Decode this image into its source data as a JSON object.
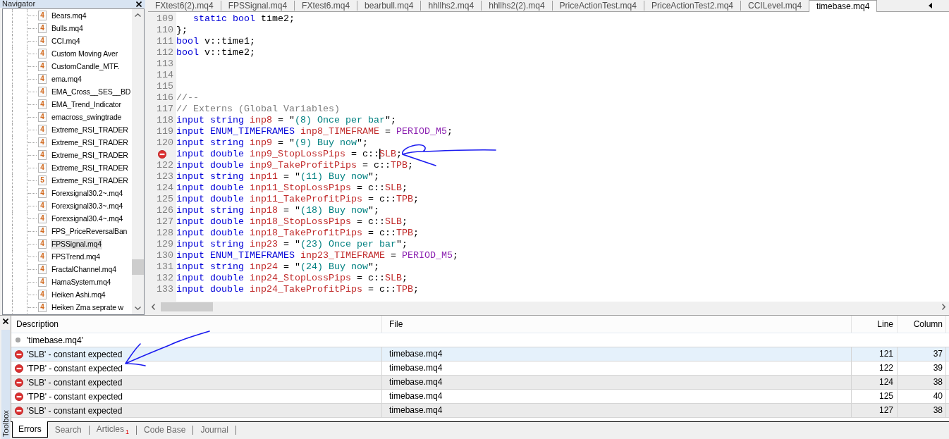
{
  "navigator": {
    "title": "Navigator",
    "items": [
      {
        "label": "Bears.mq4",
        "file_version": "4",
        "selected": false
      },
      {
        "label": "Bulls.mq4",
        "file_version": "4",
        "selected": false
      },
      {
        "label": "CCI.mq4",
        "file_version": "4",
        "selected": false
      },
      {
        "label": "Custom Moving Aver",
        "file_version": "4",
        "selected": false
      },
      {
        "label": "CustomCandle_MTF.",
        "file_version": "4",
        "selected": false
      },
      {
        "label": "ema.mq4",
        "file_version": "4",
        "selected": false
      },
      {
        "label": "EMA_Cross__SES__BD",
        "file_version": "4",
        "selected": false
      },
      {
        "label": "EMA_Trend_Indicator",
        "file_version": "4",
        "selected": false
      },
      {
        "label": "emacross_swingtrade",
        "file_version": "4",
        "selected": false
      },
      {
        "label": "Extreme_RSI_TRADER",
        "file_version": "4",
        "selected": false
      },
      {
        "label": "Extreme_RSI_TRADER",
        "file_version": "4",
        "selected": false
      },
      {
        "label": "Extreme_RSI_TRADER",
        "file_version": "4",
        "selected": false
      },
      {
        "label": "Extreme_RSI_TRADER",
        "file_version": "4",
        "selected": false
      },
      {
        "label": "Extreme_RSI_TRADER",
        "file_version": "5",
        "selected": false
      },
      {
        "label": "Forexsignal30.2~.mq4",
        "file_version": "4",
        "selected": false
      },
      {
        "label": "Forexsignal30.3~.mq4",
        "file_version": "4",
        "selected": false
      },
      {
        "label": "Forexsignal30.4~.mq4",
        "file_version": "4",
        "selected": false
      },
      {
        "label": "FPS_PriceReversalBan",
        "file_version": "4",
        "selected": false
      },
      {
        "label": "FPSSignal.mq4",
        "file_version": "4",
        "selected": true
      },
      {
        "label": "FPSTrend.mq4",
        "file_version": "4",
        "selected": false
      },
      {
        "label": "FractalChannel.mq4",
        "file_version": "4",
        "selected": false
      },
      {
        "label": "HamaSystem.mq4",
        "file_version": "4",
        "selected": false
      },
      {
        "label": "Heiken Ashi.mq4",
        "file_version": "4",
        "selected": false
      },
      {
        "label": "Heiken Zma seprate w",
        "file_version": "4",
        "selected": false
      }
    ]
  },
  "editor": {
    "tabs": [
      {
        "label": "FXtest6(2).mq4",
        "selected": false
      },
      {
        "label": "FPSSignal.mq4",
        "selected": false
      },
      {
        "label": "FXtest6.mq4",
        "selected": false
      },
      {
        "label": "bearbull.mq4",
        "selected": false
      },
      {
        "label": "hhllhs2.mq4",
        "selected": false
      },
      {
        "label": "hhllhs2(2).mq4",
        "selected": false
      },
      {
        "label": "PriceActionTest.mq4",
        "selected": false
      },
      {
        "label": "PriceActionTest2.mq4",
        "selected": false
      },
      {
        "label": "CCILevel.mq4",
        "selected": false
      },
      {
        "label": "timebase.mq4",
        "selected": true
      }
    ],
    "lines": [
      {
        "number": "109",
        "error": false,
        "segments": [
          {
            "kind": "keyword",
            "text": "   static bool"
          },
          {
            "kind": "plain",
            "text": " time2;"
          }
        ]
      },
      {
        "number": "110",
        "error": false,
        "segments": [
          {
            "kind": "plain",
            "text": "};"
          }
        ]
      },
      {
        "number": "111",
        "error": false,
        "segments": [
          {
            "kind": "keyword",
            "text": "bool"
          },
          {
            "kind": "plain",
            "text": " v::time1;"
          }
        ]
      },
      {
        "number": "112",
        "error": false,
        "segments": [
          {
            "kind": "keyword",
            "text": "bool"
          },
          {
            "kind": "plain",
            "text": " v::time2;"
          }
        ]
      },
      {
        "number": "113",
        "error": false
      },
      {
        "number": "114",
        "error": false
      },
      {
        "number": "115",
        "error": false
      },
      {
        "number": "116",
        "error": false,
        "segments": [
          {
            "kind": "comment",
            "text": "//--"
          }
        ]
      },
      {
        "number": "117",
        "error": false,
        "segments": [
          {
            "kind": "comment",
            "text": "// Externs (Global Variables)"
          }
        ]
      },
      {
        "number": "118",
        "error": false,
        "segments": [
          {
            "kind": "keyword",
            "text": "input string "
          },
          {
            "kind": "identifier",
            "text": "inp8"
          },
          {
            "kind": "plain",
            "text": " = \""
          },
          {
            "kind": "string",
            "text": "(8) Once per bar"
          },
          {
            "kind": "plain",
            "text": "\";"
          }
        ]
      },
      {
        "number": "119",
        "error": false,
        "segments": [
          {
            "kind": "keyword",
            "text": "input ENUM_TIMEFRAMES "
          },
          {
            "kind": "identifier",
            "text": "inp8_TIMEFRAME"
          },
          {
            "kind": "plain",
            "text": " = "
          },
          {
            "kind": "constant",
            "text": "PERIOD_M5"
          },
          {
            "kind": "plain",
            "text": ";"
          }
        ]
      },
      {
        "number": "120",
        "error": false,
        "segments": [
          {
            "kind": "keyword",
            "text": "input string "
          },
          {
            "kind": "identifier",
            "text": "inp9"
          },
          {
            "kind": "plain",
            "text": " = \""
          },
          {
            "kind": "string",
            "text": "(9) Buy now"
          },
          {
            "kind": "plain",
            "text": "\";"
          }
        ]
      },
      {
        "error": true,
        "segments": [
          {
            "kind": "keyword",
            "text": "input double "
          },
          {
            "kind": "identifier",
            "text": "inp9_StopLossPips"
          },
          {
            "kind": "plain",
            "text": " = c::"
          },
          {
            "kind": "identifier",
            "text": "SLB",
            "caret_before": true
          },
          {
            "kind": "plain",
            "text": ";"
          }
        ]
      },
      {
        "number": "122",
        "error": false,
        "segments": [
          {
            "kind": "keyword",
            "text": "input double "
          },
          {
            "kind": "identifier",
            "text": "inp9_TakeProfitPips"
          },
          {
            "kind": "plain",
            "text": " = c::"
          },
          {
            "kind": "identifier",
            "text": "TPB"
          },
          {
            "kind": "plain",
            "text": ";"
          }
        ]
      },
      {
        "number": "123",
        "error": false,
        "segments": [
          {
            "kind": "keyword",
            "text": "input string "
          },
          {
            "kind": "identifier",
            "text": "inp11"
          },
          {
            "kind": "plain",
            "text": " = \""
          },
          {
            "kind": "string",
            "text": "(11) Buy now"
          },
          {
            "kind": "plain",
            "text": "\";"
          }
        ]
      },
      {
        "number": "124",
        "error": false,
        "segments": [
          {
            "kind": "keyword",
            "text": "input double "
          },
          {
            "kind": "identifier",
            "text": "inp11_StopLossPips"
          },
          {
            "kind": "plain",
            "text": " = c::"
          },
          {
            "kind": "identifier",
            "text": "SLB"
          },
          {
            "kind": "plain",
            "text": ";"
          }
        ]
      },
      {
        "number": "125",
        "error": false,
        "segments": [
          {
            "kind": "keyword",
            "text": "input double "
          },
          {
            "kind": "identifier",
            "text": "inp11_TakeProfitPips"
          },
          {
            "kind": "plain",
            "text": " = c::"
          },
          {
            "kind": "identifier",
            "text": "TPB"
          },
          {
            "kind": "plain",
            "text": ";"
          }
        ]
      },
      {
        "number": "126",
        "error": false,
        "segments": [
          {
            "kind": "keyword",
            "text": "input string "
          },
          {
            "kind": "identifier",
            "text": "inp18"
          },
          {
            "kind": "plain",
            "text": " = \""
          },
          {
            "kind": "string",
            "text": "(18) Buy now"
          },
          {
            "kind": "plain",
            "text": "\";"
          }
        ]
      },
      {
        "number": "127",
        "error": false,
        "segments": [
          {
            "kind": "keyword",
            "text": "input double "
          },
          {
            "kind": "identifier",
            "text": "inp18_StopLossPips"
          },
          {
            "kind": "plain",
            "text": " = c::"
          },
          {
            "kind": "identifier",
            "text": "SLB"
          },
          {
            "kind": "plain",
            "text": ";"
          }
        ]
      },
      {
        "number": "128",
        "error": false,
        "segments": [
          {
            "kind": "keyword",
            "text": "input double "
          },
          {
            "kind": "identifier",
            "text": "inp18_TakeProfitPips"
          },
          {
            "kind": "plain",
            "text": " = c::"
          },
          {
            "kind": "identifier",
            "text": "TPB"
          },
          {
            "kind": "plain",
            "text": ";"
          }
        ]
      },
      {
        "number": "129",
        "error": false,
        "segments": [
          {
            "kind": "keyword",
            "text": "input string "
          },
          {
            "kind": "identifier",
            "text": "inp23"
          },
          {
            "kind": "plain",
            "text": " = \""
          },
          {
            "kind": "string",
            "text": "(23) Once per bar"
          },
          {
            "kind": "plain",
            "text": "\";"
          }
        ]
      },
      {
        "number": "130",
        "error": false,
        "segments": [
          {
            "kind": "keyword",
            "text": "input ENUM_TIMEFRAMES "
          },
          {
            "kind": "identifier",
            "text": "inp23_TIMEFRAME"
          },
          {
            "kind": "plain",
            "text": " = "
          },
          {
            "kind": "constant",
            "text": "PERIOD_M5"
          },
          {
            "kind": "plain",
            "text": ";"
          }
        ]
      },
      {
        "number": "131",
        "error": false,
        "segments": [
          {
            "kind": "keyword",
            "text": "input string "
          },
          {
            "kind": "identifier",
            "text": "inp24"
          },
          {
            "kind": "plain",
            "text": " = \""
          },
          {
            "kind": "string",
            "text": "(24) Buy now"
          },
          {
            "kind": "plain",
            "text": "\";"
          }
        ]
      },
      {
        "number": "132",
        "error": false,
        "segments": [
          {
            "kind": "keyword",
            "text": "input double "
          },
          {
            "kind": "identifier",
            "text": "inp24_StopLossPips"
          },
          {
            "kind": "plain",
            "text": " = c::"
          },
          {
            "kind": "identifier",
            "text": "SLB"
          },
          {
            "kind": "plain",
            "text": ";"
          }
        ]
      },
      {
        "number": "133",
        "error": false,
        "segments": [
          {
            "kind": "keyword",
            "text": "input double "
          },
          {
            "kind": "identifier",
            "text": "inp24_TakeProfitPips"
          },
          {
            "kind": "plain",
            "text": " = c::"
          },
          {
            "kind": "identifier",
            "text": "TPB"
          },
          {
            "kind": "plain",
            "text": ";"
          }
        ]
      }
    ]
  },
  "toolbox": {
    "title": "Toolbox",
    "columns": [
      "Description",
      "File",
      "Line",
      "Column"
    ],
    "rows": [
      {
        "kind": "file",
        "description": "'timebase.mq4'",
        "selected": false
      },
      {
        "kind": "error",
        "description": "'SLB' - constant expected",
        "file": "timebase.mq4",
        "line": "121",
        "column": "37",
        "selected": true
      },
      {
        "kind": "error",
        "description": "'TPB' - constant expected",
        "file": "timebase.mq4",
        "line": "122",
        "column": "39",
        "selected": false
      },
      {
        "kind": "error",
        "description": "'SLB' - constant expected",
        "file": "timebase.mq4",
        "line": "124",
        "column": "38",
        "selected": false
      },
      {
        "kind": "error",
        "description": "'TPB' - constant expected",
        "file": "timebase.mq4",
        "line": "125",
        "column": "40",
        "selected": false
      },
      {
        "kind": "error",
        "description": "'SLB' - constant expected",
        "file": "timebase.mq4",
        "line": "127",
        "column": "38",
        "selected": false
      }
    ],
    "tabs": [
      {
        "label": "Errors",
        "selected": true
      },
      {
        "label": "Search",
        "selected": false
      },
      {
        "label": "Articles",
        "badge": "1",
        "selected": false
      },
      {
        "label": "Code Base",
        "selected": false
      },
      {
        "label": "Journal",
        "selected": false
      }
    ]
  }
}
